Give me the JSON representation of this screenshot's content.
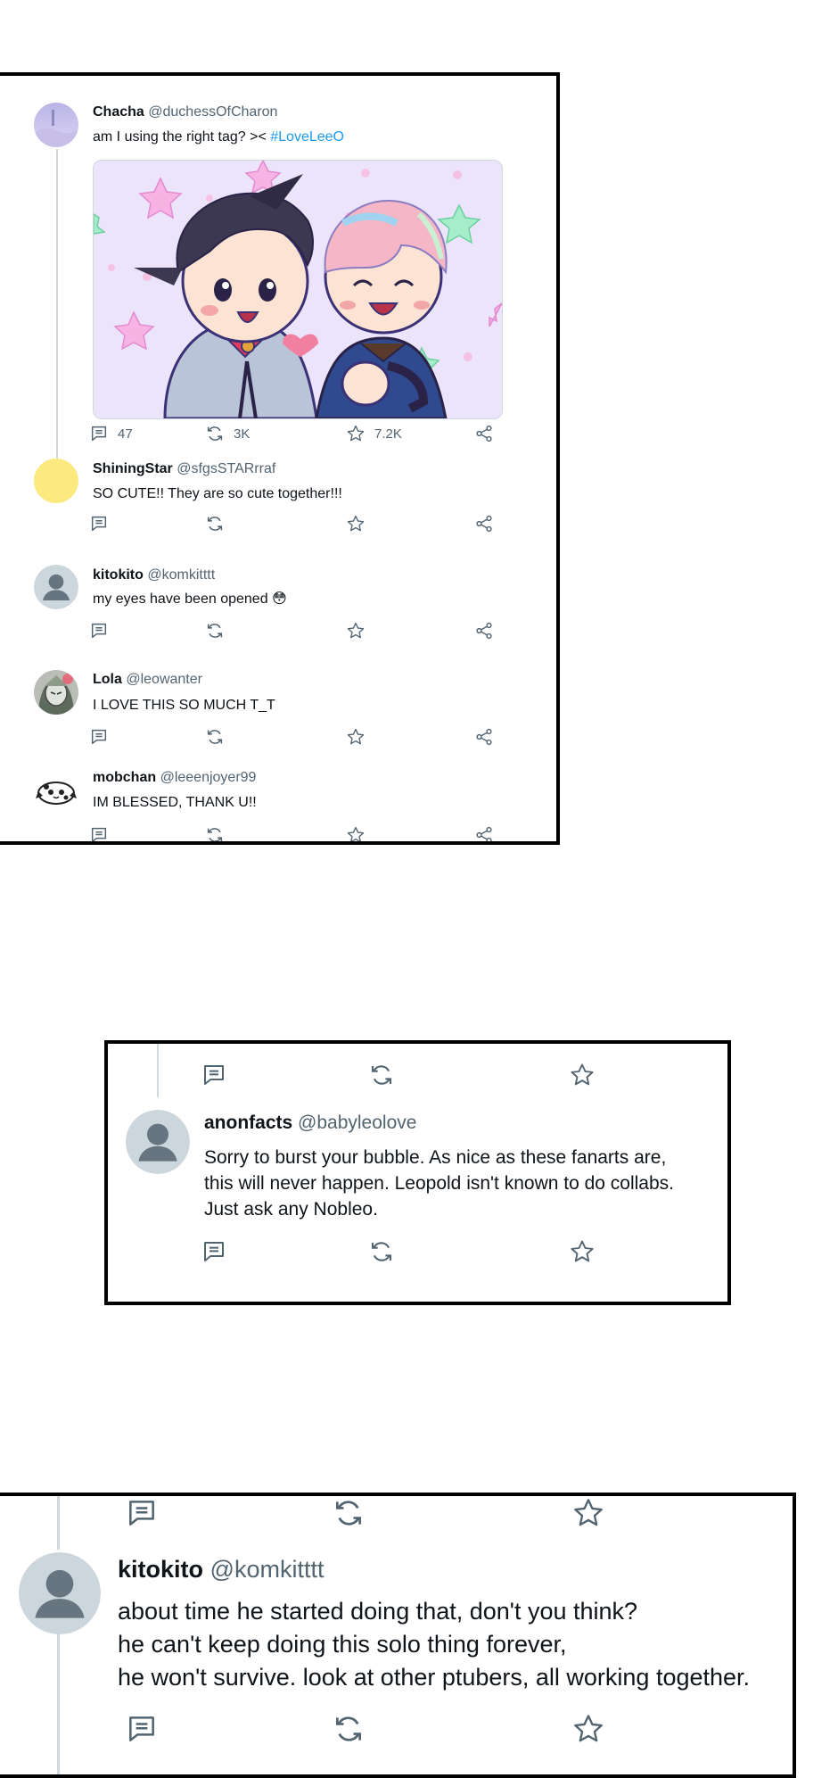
{
  "panel1": {
    "main_post": {
      "name": "Chacha",
      "handle": "@duchessOfCharon",
      "text": "am I using the right tag? ><",
      "hashtag": "#LoveLeeO",
      "counts": {
        "reply": "47",
        "retweet": "3K",
        "like": "7.2K"
      }
    },
    "replies": [
      {
        "name": "ShiningStar",
        "handle": "@sfgsSTARrraf",
        "text": "SO CUTE!! They are so cute together!!!"
      },
      {
        "name": "kitokito",
        "handle": "@komkitttt",
        "text": "my eyes have been opened 😳"
      },
      {
        "name": "Lola",
        "handle": "@leowanter",
        "text": "I LOVE THIS SO MUCH T_T"
      },
      {
        "name": "mobchan",
        "handle": "@leeenjoyer99",
        "text": "IM BLESSED, THANK U!!"
      }
    ]
  },
  "panel2": {
    "reply": {
      "name": "anonfacts",
      "handle": "@babyleolove",
      "text": "Sorry to burst your bubble. As nice as these fanarts are,\nthis will never happen. Leopold isn't known to do collabs.\nJust ask any Nobleo."
    }
  },
  "panel3": {
    "reply": {
      "name": "kitokito",
      "handle": "@komkitttt",
      "text": "about time he started doing that, don't you think?\nhe can't keep doing this solo thing forever,\nhe won't survive. look at other ptubers, all working together."
    }
  },
  "icons": [
    "reply-icon",
    "retweet-icon",
    "like-icon",
    "share-icon",
    "default-avatar-icon"
  ],
  "colors": {
    "link": "#1d9bf0",
    "muted": "#536471",
    "thread_line": "#cfd9de",
    "panel_border": "#000000"
  }
}
